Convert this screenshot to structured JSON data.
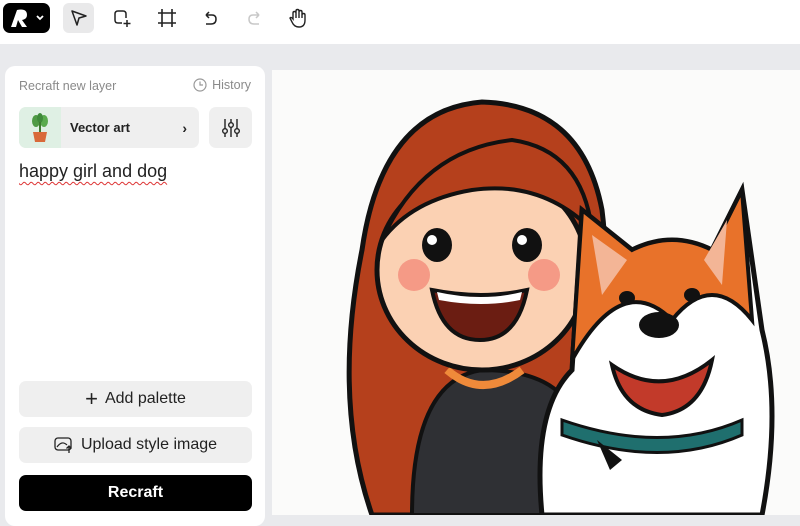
{
  "toolbar": {
    "tools": [
      "logo-menu",
      "select",
      "add-frame",
      "crop",
      "undo",
      "redo",
      "hand"
    ]
  },
  "panel": {
    "title": "Recraft new layer",
    "history_label": "History",
    "style_label": "Vector art",
    "prompt": "happy girl and dog",
    "add_palette_label": "Add palette",
    "upload_style_label": "Upload style image",
    "recraft_label": "Recraft"
  },
  "colors": {
    "accent": "#000000",
    "panel_bg": "#ffffff",
    "app_bg": "#e9eaed"
  }
}
